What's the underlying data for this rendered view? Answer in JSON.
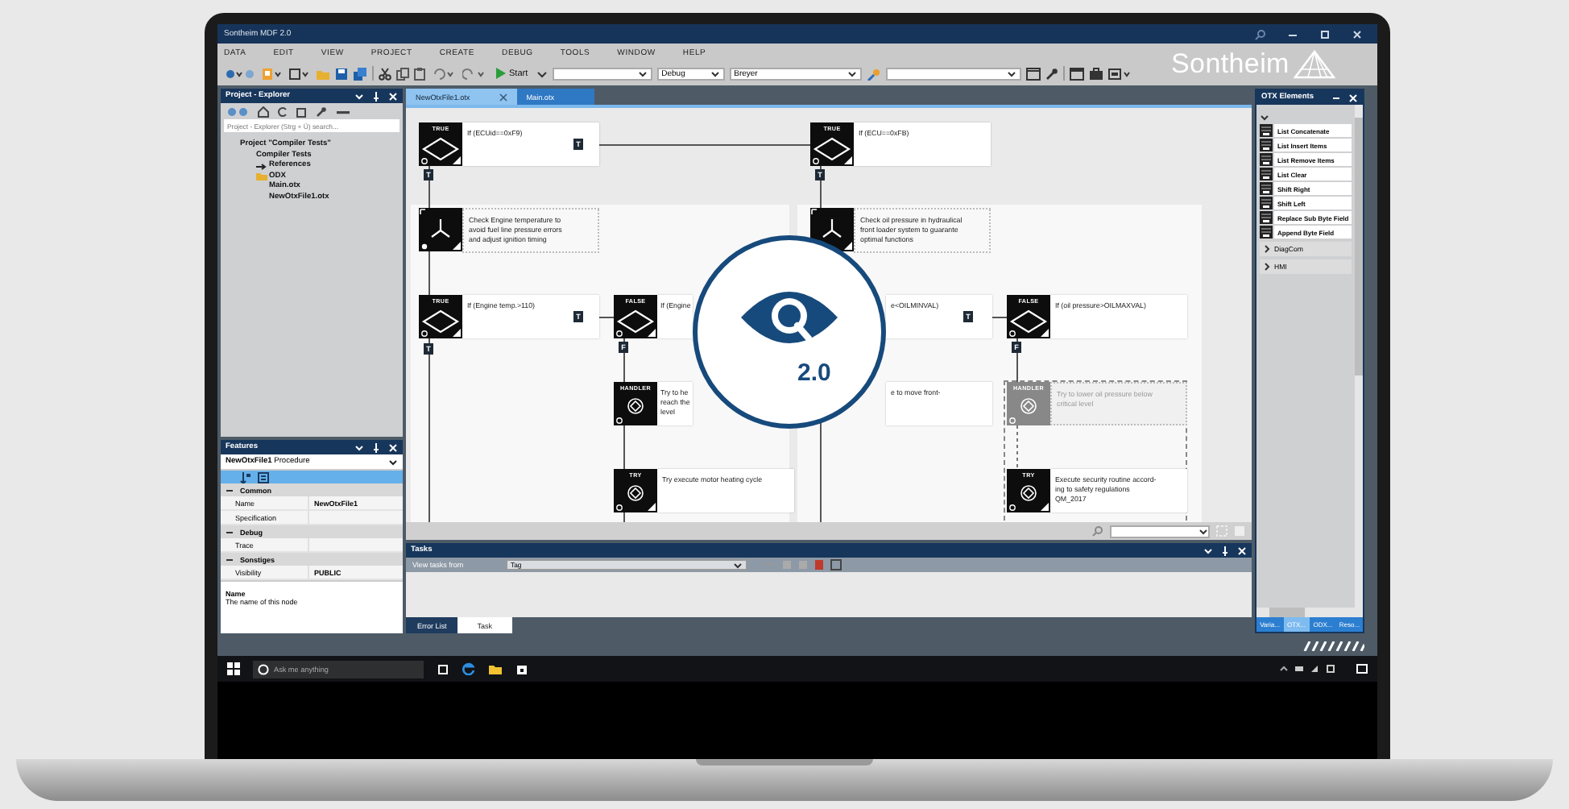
{
  "window": {
    "title": "Sontheim MDF 2.0"
  },
  "menu": [
    "DATA",
    "EDIT",
    "VIEW",
    "PROJECT",
    "CREATE",
    "DEBUG",
    "TOOLS",
    "WINDOW",
    "HELP"
  ],
  "toolbar": {
    "start": "Start",
    "configuration": "Debug",
    "user": "Breyer"
  },
  "logo": "Sontheim",
  "explorer": {
    "title": "Project - Explorer",
    "search": {
      "placeholder": "Project - Explorer (Strg + Ü) search..."
    },
    "tree": [
      {
        "label": "Project \"Compiler Tests\"",
        "kind": "solution",
        "children": [
          {
            "label": "Compiler Tests",
            "kind": "project",
            "children": [
              {
                "label": "References",
                "kind": "reference"
              },
              {
                "label": "ODX",
                "kind": "folder"
              },
              {
                "label": "Main.otx",
                "kind": "file"
              },
              {
                "label": "NewOtxFile1.otx",
                "kind": "file"
              }
            ]
          }
        ]
      }
    ]
  },
  "features": {
    "title": "Features",
    "object": "**NewOtxFile1** Procedure",
    "categories": [
      {
        "name": "Common",
        "expanded": true,
        "properties": [
          {
            "name": "Name",
            "value": "NewOtxFile1"
          },
          {
            "name": "Specification"
          }
        ]
      },
      {
        "name": "Debug",
        "expanded": true,
        "properties": [
          {
            "name": "Trace"
          }
        ]
      },
      {
        "name": "Sonstiges",
        "expanded": true,
        "properties": [
          {
            "name": "Visibility",
            "value": "PUBLIC"
          }
        ]
      }
    ],
    "description": {
      "title": "Name",
      "text": "The name of this node"
    }
  },
  "editor": {
    "tabs": [
      {
        "label": "NewOtxFile1.otx",
        "selected": true
      },
      {
        "label": "Main.otx",
        "selected": false
      }
    ],
    "nodes": [
      {
        "kind": "condition",
        "type": "TRUE",
        "text": "If (ECUid==0xF9)",
        "disabled": false
      },
      {
        "kind": "condition",
        "type": "TRUE",
        "text": "If (ECU==0xFB)",
        "disabled": false
      },
      {
        "kind": "action",
        "text": "Check Engine temperature to\navoid fuel line pressure errors\nand adjust ignition timing",
        "disabled": false
      },
      {
        "kind": "action",
        "text": "Check oil pressure in hydraulical\nfront loader system to guarante\noptimal functions",
        "disabled": false
      },
      {
        "kind": "condition",
        "type": "TRUE",
        "text": "If (Engine temp.>110)",
        "disabled": false
      },
      {
        "kind": "condition",
        "type": "FALSE",
        "text": "If (Engine",
        "disabled": false
      },
      {
        "kind": "hidden",
        "text": "e<OILMINVAL)",
        "disabled": false
      },
      {
        "kind": "condition",
        "type": "FALSE",
        "text": "If (oil pressure>OILMAXVAL)",
        "disabled": false
      },
      {
        "kind": "handler",
        "type": "HANDLER",
        "text": "Try to he\nreach the\nlevel",
        "disabled": false
      },
      {
        "kind": "hidden",
        "text": "e to move front-",
        "disabled": false
      },
      {
        "kind": "handler",
        "type": "HANDLER",
        "text": "Try to lower oil pressure below\ncritical level",
        "disabled": true
      },
      {
        "kind": "try",
        "type": "TRY",
        "text": "Try execute motor heating cycle",
        "disabled": false
      },
      {
        "kind": "try",
        "type": "TRY",
        "text": "Execute security routine accord-\ning to safety regulations\nQM_2017",
        "disabled": false
      }
    ],
    "ports": [
      {
        "label": "T"
      },
      {
        "label": "T"
      },
      {
        "label": "T"
      },
      {
        "label": "T"
      },
      {
        "label": "T"
      },
      {
        "label": "F"
      },
      {
        "label": "T"
      },
      {
        "label": "F"
      }
    ],
    "badge": "2.0"
  },
  "tasks": {
    "title": "Tasks",
    "filter_label": "View tasks from",
    "filter": "Tag",
    "tabs": [
      {
        "label": "Error List",
        "selected": false
      },
      {
        "label": "Task",
        "selected": true
      }
    ]
  },
  "otx_elements": {
    "title": "OTX Elements",
    "items": [
      "List Concatenate",
      "List Insert Items",
      "List Remove Items",
      "List Clear",
      "Shift Right",
      "Shift Left",
      "Replace Sub Byte Field",
      "Append Byte Field"
    ],
    "groups": [
      {
        "label": "DiagCom",
        "expanded": false
      },
      {
        "label": "HMI",
        "expanded": false
      }
    ],
    "tabs": [
      {
        "label": "Varia...",
        "selected": false
      },
      {
        "label": "OTX...",
        "selected": true
      },
      {
        "label": "ODX...",
        "selected": false
      },
      {
        "label": "Reso...",
        "selected": false
      }
    ]
  },
  "taskbar": {
    "search": {
      "placeholder": "Ask me anything"
    }
  }
}
